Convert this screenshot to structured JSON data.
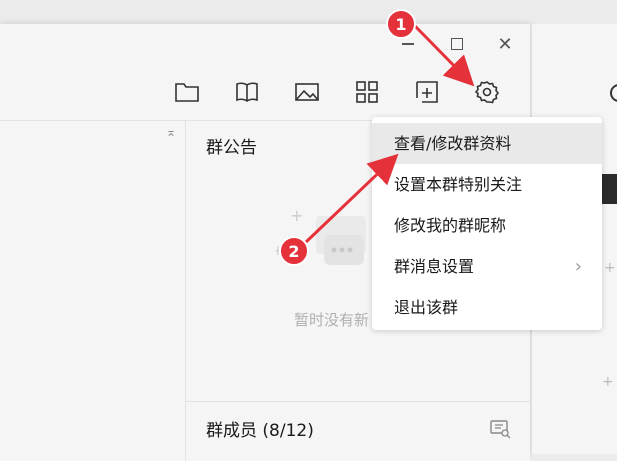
{
  "window": {
    "controls": {
      "minimize_icon": "minimize-icon",
      "maximize_icon": "maximize-icon",
      "close_icon": "close-icon",
      "close_glyph": "✕"
    }
  },
  "toolbar": {
    "icons": [
      "folder-icon",
      "book-icon",
      "image-icon",
      "grid-apps-icon",
      "add-frame-icon",
      "settings-gear-icon"
    ]
  },
  "left_panel": {
    "collapse_glyph": "⌅"
  },
  "notice": {
    "title": "群公告",
    "empty_text": "暂时没有新"
  },
  "members": {
    "title": "群成员 (8/12)"
  },
  "context_menu": {
    "items": [
      {
        "label": "查看/修改群资料",
        "active": true
      },
      {
        "label": "设置本群特别关注"
      },
      {
        "label": "修改我的群昵称"
      },
      {
        "label": "群消息设置",
        "submenu": true,
        "chevron": "›"
      },
      {
        "label": "退出该群"
      }
    ]
  },
  "annotations": {
    "badge_1": "1",
    "badge_2": "2",
    "color": "#e5323a"
  },
  "right_window": {
    "plus_glyph": "+"
  }
}
